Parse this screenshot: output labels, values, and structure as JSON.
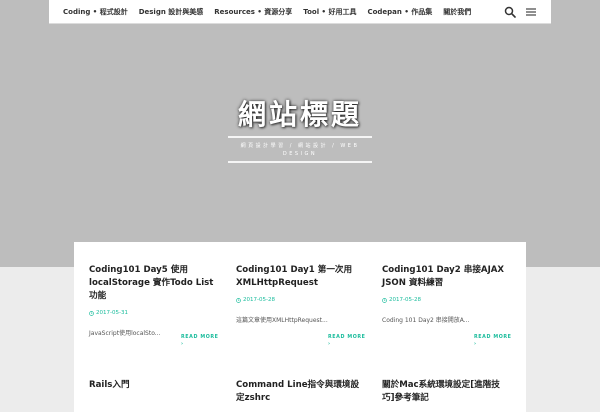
{
  "nav": {
    "items": [
      {
        "label": "Coding • 程式設計"
      },
      {
        "label": "Design 設計與美感"
      },
      {
        "label": "Resources • 資源分享"
      },
      {
        "label": "Tool • 好用工具"
      },
      {
        "label": "Codepan • 作品集"
      },
      {
        "label": "關於我們"
      }
    ],
    "icons": [
      "search-icon",
      "menu-icon"
    ]
  },
  "hero": {
    "title": "網站標題",
    "subtitle": "網頁設計學習 / 網站設計 / WEB DESIGN"
  },
  "posts": [
    {
      "title": "Coding101 Day5 使用localStorage 實作Todo List功能",
      "date": "2017-05-31",
      "excerpt": "JavaScript使用localSto...",
      "more": "READ MORE"
    },
    {
      "title": "Coding101 Day1 第一次用XMLHttpRequest",
      "date": "2017-05-28",
      "excerpt": "這篇文章使用XMLHttpRequest...",
      "more": "READ MORE"
    },
    {
      "title": "Coding101 Day2 串接AJAX JSON 資料練習",
      "date": "2017-05-28",
      "excerpt": "Coding 101 Day2 串接開放A...",
      "more": "READ MORE"
    },
    {
      "title": "Rails入門",
      "date": "",
      "excerpt": "",
      "more": ""
    },
    {
      "title": "Command Line指令與環境設定zshrc",
      "date": "",
      "excerpt": "",
      "more": ""
    },
    {
      "title": "關於Mac系統環境設定[進階技巧]參考筆記",
      "date": "",
      "excerpt": "",
      "more": ""
    }
  ],
  "colors": {
    "accent": "#1abc9c",
    "hero_bg": "#bdbdbd",
    "page_bg": "#ececec"
  }
}
